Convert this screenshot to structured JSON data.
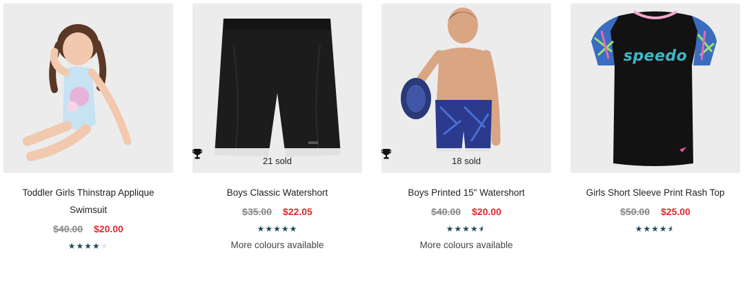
{
  "products": [
    {
      "title": "Toddler Girls Thinstrap Applique Swimsuit",
      "was_price": "$40.00",
      "now_price": "$20.00",
      "rating_stars": 4,
      "sold_text": "",
      "more_colours": ""
    },
    {
      "title": "Boys Classic Watershort",
      "was_price": "$35.00",
      "now_price": "$22.05",
      "rating_stars": 5,
      "sold_text": "21 sold",
      "more_colours": "More colours available"
    },
    {
      "title": "Boys Printed 15\" Watershort",
      "was_price": "$40.00",
      "now_price": "$20.00",
      "rating_stars": 4.5,
      "sold_text": "18 sold",
      "more_colours": "More colours available"
    },
    {
      "title": "Girls Short Sleeve Print Rash Top",
      "was_price": "$50.00",
      "now_price": "$25.00",
      "rating_stars": 4.5,
      "sold_text": "",
      "more_colours": ""
    }
  ],
  "brand_logo_text": "speedo",
  "colors": {
    "sale_red": "#e4262b",
    "star_teal": "#1b4d5a"
  }
}
